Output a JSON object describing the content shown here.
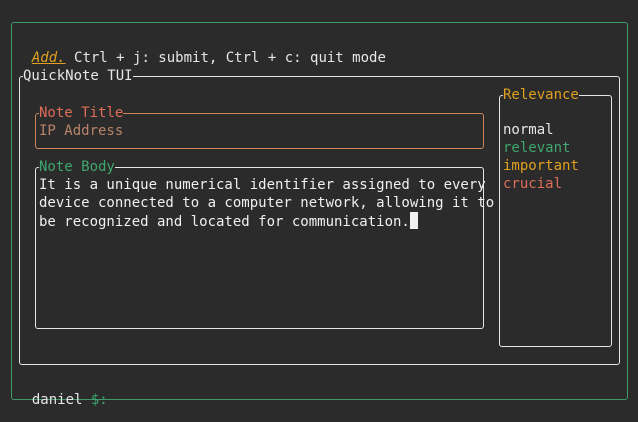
{
  "mode": {
    "name": "Add.",
    "help": "Ctrl + j: submit, Ctrl + c: quit mode"
  },
  "app": {
    "title": "QuickNote TUI"
  },
  "note_title": {
    "legend": "Note Title",
    "value": "IP Address"
  },
  "note_body": {
    "legend": "Note Body",
    "lines": [
      "It is a unique numerical identifier assigned to every",
      "device connected to a computer network, allowing it to",
      "be recognized and located for communication."
    ]
  },
  "relevance": {
    "legend": "Relevance",
    "options": [
      "normal",
      "relevant",
      "important",
      "crucial"
    ],
    "colors": [
      "#e6e6e6",
      "#3fa66e",
      "#e0a020",
      "#e06c5a"
    ]
  },
  "prompt": {
    "user": "daniel",
    "symbol": "$:"
  },
  "colors": {
    "background": "#2b2b2b",
    "outer_border": "#3f9a6a",
    "accent_yellow": "#e0a020",
    "accent_green": "#3fa66e",
    "accent_red": "#e06c5a"
  }
}
